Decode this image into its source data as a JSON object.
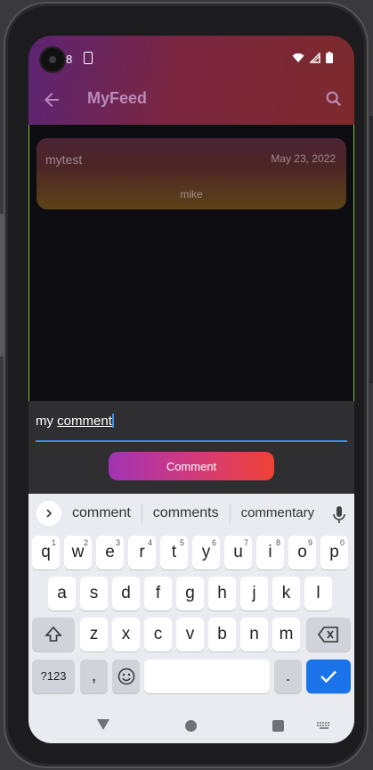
{
  "status_bar": {
    "time": "8"
  },
  "app_bar": {
    "title": "MyFeed"
  },
  "post": {
    "title": "mytest",
    "date": "May 23, 2022",
    "author": "mike"
  },
  "comment_input": {
    "value_plain": "my ",
    "value_underlined": "comment"
  },
  "comment_button": {
    "label": "Comment"
  },
  "suggestions": [
    "comment",
    "comments",
    "commentary"
  ],
  "keyboard": {
    "row1": [
      {
        "k": "q",
        "h": "1"
      },
      {
        "k": "w",
        "h": "2"
      },
      {
        "k": "e",
        "h": "3"
      },
      {
        "k": "r",
        "h": "4"
      },
      {
        "k": "t",
        "h": "5"
      },
      {
        "k": "y",
        "h": "6"
      },
      {
        "k": "u",
        "h": "7"
      },
      {
        "k": "i",
        "h": "8"
      },
      {
        "k": "o",
        "h": "9"
      },
      {
        "k": "p",
        "h": "0"
      }
    ],
    "row2": [
      "a",
      "s",
      "d",
      "f",
      "g",
      "h",
      "j",
      "k",
      "l"
    ],
    "row3": [
      "z",
      "x",
      "c",
      "v",
      "b",
      "n",
      "m"
    ],
    "symbols": "?123",
    "comma": ",",
    "period": "."
  },
  "colors": {
    "accent_blue": "#1a73e8",
    "button_gradient_start": "#a233b4",
    "button_gradient_end": "#ef4234",
    "feed_border": "#8bbd36"
  },
  "icons": {
    "back": "arrow-left-icon",
    "search": "magnifier-icon",
    "mic": "microphone-icon",
    "emoji": "smiley-icon",
    "shift": "shift-arrow-icon",
    "backspace": "backspace-icon",
    "enter": "checkmark-icon"
  }
}
